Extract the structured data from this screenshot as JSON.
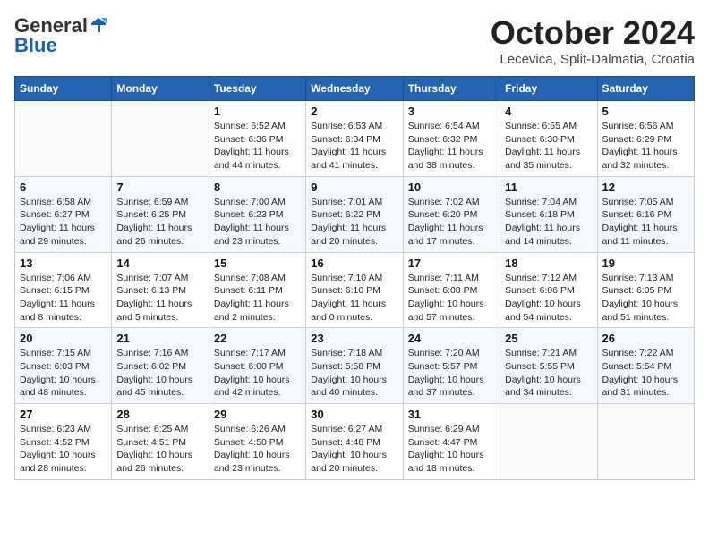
{
  "logo": {
    "general": "General",
    "blue": "Blue"
  },
  "title": "October 2024",
  "subtitle": "Lecevica, Split-Dalmatia, Croatia",
  "days_of_week": [
    "Sunday",
    "Monday",
    "Tuesday",
    "Wednesday",
    "Thursday",
    "Friday",
    "Saturday"
  ],
  "weeks": [
    [
      {
        "day": "",
        "sunrise": "",
        "sunset": "",
        "daylight": ""
      },
      {
        "day": "",
        "sunrise": "",
        "sunset": "",
        "daylight": ""
      },
      {
        "day": "1",
        "sunrise": "Sunrise: 6:52 AM",
        "sunset": "Sunset: 6:36 PM",
        "daylight": "Daylight: 11 hours and 44 minutes."
      },
      {
        "day": "2",
        "sunrise": "Sunrise: 6:53 AM",
        "sunset": "Sunset: 6:34 PM",
        "daylight": "Daylight: 11 hours and 41 minutes."
      },
      {
        "day": "3",
        "sunrise": "Sunrise: 6:54 AM",
        "sunset": "Sunset: 6:32 PM",
        "daylight": "Daylight: 11 hours and 38 minutes."
      },
      {
        "day": "4",
        "sunrise": "Sunrise: 6:55 AM",
        "sunset": "Sunset: 6:30 PM",
        "daylight": "Daylight: 11 hours and 35 minutes."
      },
      {
        "day": "5",
        "sunrise": "Sunrise: 6:56 AM",
        "sunset": "Sunset: 6:29 PM",
        "daylight": "Daylight: 11 hours and 32 minutes."
      }
    ],
    [
      {
        "day": "6",
        "sunrise": "Sunrise: 6:58 AM",
        "sunset": "Sunset: 6:27 PM",
        "daylight": "Daylight: 11 hours and 29 minutes."
      },
      {
        "day": "7",
        "sunrise": "Sunrise: 6:59 AM",
        "sunset": "Sunset: 6:25 PM",
        "daylight": "Daylight: 11 hours and 26 minutes."
      },
      {
        "day": "8",
        "sunrise": "Sunrise: 7:00 AM",
        "sunset": "Sunset: 6:23 PM",
        "daylight": "Daylight: 11 hours and 23 minutes."
      },
      {
        "day": "9",
        "sunrise": "Sunrise: 7:01 AM",
        "sunset": "Sunset: 6:22 PM",
        "daylight": "Daylight: 11 hours and 20 minutes."
      },
      {
        "day": "10",
        "sunrise": "Sunrise: 7:02 AM",
        "sunset": "Sunset: 6:20 PM",
        "daylight": "Daylight: 11 hours and 17 minutes."
      },
      {
        "day": "11",
        "sunrise": "Sunrise: 7:04 AM",
        "sunset": "Sunset: 6:18 PM",
        "daylight": "Daylight: 11 hours and 14 minutes."
      },
      {
        "day": "12",
        "sunrise": "Sunrise: 7:05 AM",
        "sunset": "Sunset: 6:16 PM",
        "daylight": "Daylight: 11 hours and 11 minutes."
      }
    ],
    [
      {
        "day": "13",
        "sunrise": "Sunrise: 7:06 AM",
        "sunset": "Sunset: 6:15 PM",
        "daylight": "Daylight: 11 hours and 8 minutes."
      },
      {
        "day": "14",
        "sunrise": "Sunrise: 7:07 AM",
        "sunset": "Sunset: 6:13 PM",
        "daylight": "Daylight: 11 hours and 5 minutes."
      },
      {
        "day": "15",
        "sunrise": "Sunrise: 7:08 AM",
        "sunset": "Sunset: 6:11 PM",
        "daylight": "Daylight: 11 hours and 2 minutes."
      },
      {
        "day": "16",
        "sunrise": "Sunrise: 7:10 AM",
        "sunset": "Sunset: 6:10 PM",
        "daylight": "Daylight: 11 hours and 0 minutes."
      },
      {
        "day": "17",
        "sunrise": "Sunrise: 7:11 AM",
        "sunset": "Sunset: 6:08 PM",
        "daylight": "Daylight: 10 hours and 57 minutes."
      },
      {
        "day": "18",
        "sunrise": "Sunrise: 7:12 AM",
        "sunset": "Sunset: 6:06 PM",
        "daylight": "Daylight: 10 hours and 54 minutes."
      },
      {
        "day": "19",
        "sunrise": "Sunrise: 7:13 AM",
        "sunset": "Sunset: 6:05 PM",
        "daylight": "Daylight: 10 hours and 51 minutes."
      }
    ],
    [
      {
        "day": "20",
        "sunrise": "Sunrise: 7:15 AM",
        "sunset": "Sunset: 6:03 PM",
        "daylight": "Daylight: 10 hours and 48 minutes."
      },
      {
        "day": "21",
        "sunrise": "Sunrise: 7:16 AM",
        "sunset": "Sunset: 6:02 PM",
        "daylight": "Daylight: 10 hours and 45 minutes."
      },
      {
        "day": "22",
        "sunrise": "Sunrise: 7:17 AM",
        "sunset": "Sunset: 6:00 PM",
        "daylight": "Daylight: 10 hours and 42 minutes."
      },
      {
        "day": "23",
        "sunrise": "Sunrise: 7:18 AM",
        "sunset": "Sunset: 5:58 PM",
        "daylight": "Daylight: 10 hours and 40 minutes."
      },
      {
        "day": "24",
        "sunrise": "Sunrise: 7:20 AM",
        "sunset": "Sunset: 5:57 PM",
        "daylight": "Daylight: 10 hours and 37 minutes."
      },
      {
        "day": "25",
        "sunrise": "Sunrise: 7:21 AM",
        "sunset": "Sunset: 5:55 PM",
        "daylight": "Daylight: 10 hours and 34 minutes."
      },
      {
        "day": "26",
        "sunrise": "Sunrise: 7:22 AM",
        "sunset": "Sunset: 5:54 PM",
        "daylight": "Daylight: 10 hours and 31 minutes."
      }
    ],
    [
      {
        "day": "27",
        "sunrise": "Sunrise: 6:23 AM",
        "sunset": "Sunset: 4:52 PM",
        "daylight": "Daylight: 10 hours and 28 minutes."
      },
      {
        "day": "28",
        "sunrise": "Sunrise: 6:25 AM",
        "sunset": "Sunset: 4:51 PM",
        "daylight": "Daylight: 10 hours and 26 minutes."
      },
      {
        "day": "29",
        "sunrise": "Sunrise: 6:26 AM",
        "sunset": "Sunset: 4:50 PM",
        "daylight": "Daylight: 10 hours and 23 minutes."
      },
      {
        "day": "30",
        "sunrise": "Sunrise: 6:27 AM",
        "sunset": "Sunset: 4:48 PM",
        "daylight": "Daylight: 10 hours and 20 minutes."
      },
      {
        "day": "31",
        "sunrise": "Sunrise: 6:29 AM",
        "sunset": "Sunset: 4:47 PM",
        "daylight": "Daylight: 10 hours and 18 minutes."
      },
      {
        "day": "",
        "sunrise": "",
        "sunset": "",
        "daylight": ""
      },
      {
        "day": "",
        "sunrise": "",
        "sunset": "",
        "daylight": ""
      }
    ]
  ]
}
